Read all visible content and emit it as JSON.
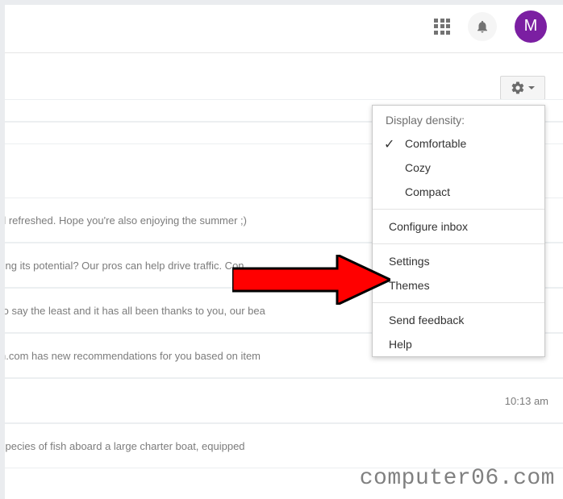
{
  "header": {
    "avatar_initial": "M"
  },
  "email_snippets": {
    "row1": "d refreshed. Hope you're also enjoying the summer ;) ",
    "row2": "ting its potential? Our pros can help drive traffic. Con",
    "row3": "to say the least and it has all been thanks to you, our bea",
    "row4": "n.com has new recommendations for you based on item",
    "row5_time": "10:13 am",
    "row6": " species of fish aboard a large charter boat, equipped"
  },
  "settings_menu": {
    "header": "Display density:",
    "density": {
      "comfortable": "Comfortable",
      "cozy": "Cozy",
      "compact": "Compact"
    },
    "configure_inbox": "Configure inbox",
    "settings": "Settings",
    "themes": "Themes",
    "send_feedback": "Send feedback",
    "help": "Help"
  },
  "watermark": "computer06.com"
}
